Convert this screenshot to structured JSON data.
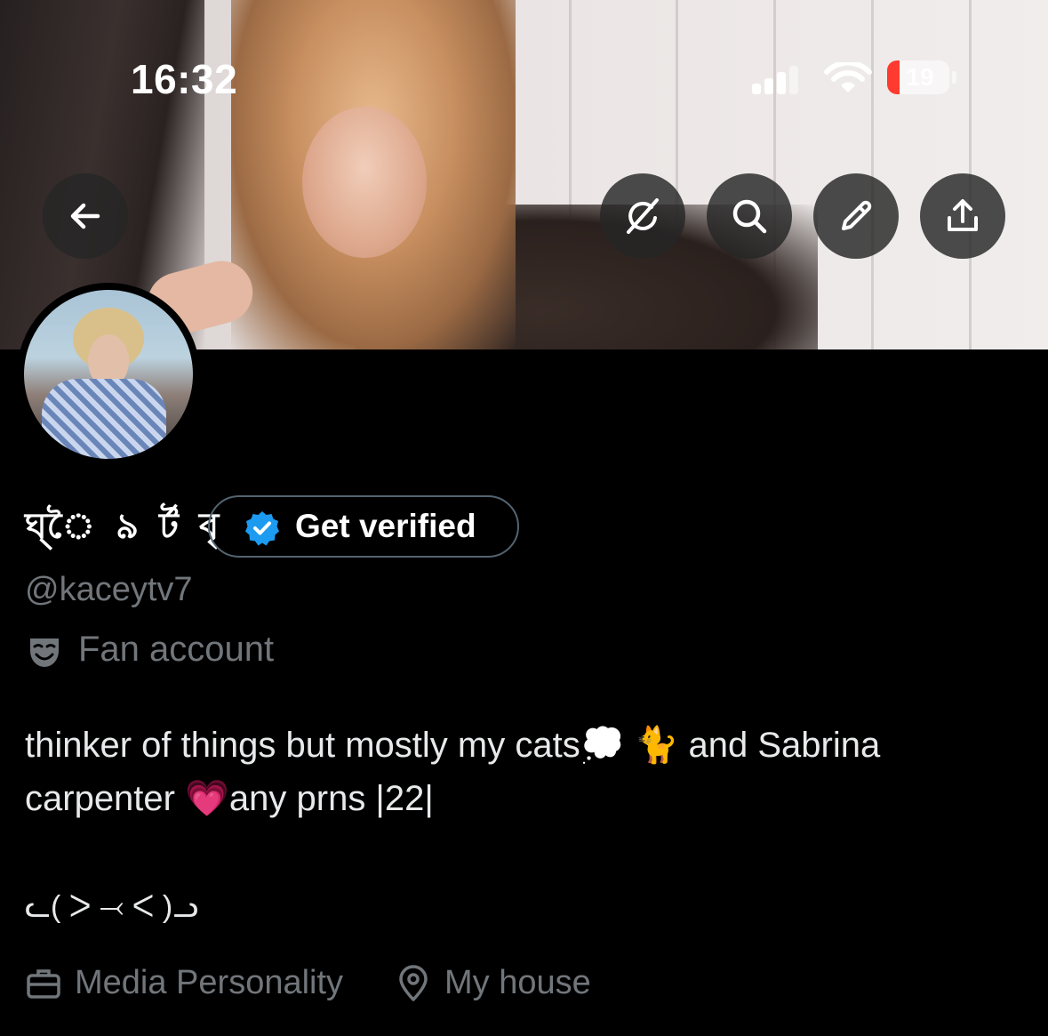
{
  "status_bar": {
    "time": "16:32",
    "battery": "19"
  },
  "profile": {
    "display_name": "ঘ্ৈ ৯ ৰ্ট বৃ",
    "get_verified_label": "Get verified",
    "handle": "@kaceytv7",
    "category": "Fan account",
    "bio_line1": "thinker of things but mostly my cats💭 🐈 and Sabrina",
    "bio_line2": "carpenter 💗any prns |22|",
    "kaomoji": "ᓚ( ᐳ ⤙ ᐸ )ᓗ",
    "profession": "Media Personality",
    "location": "My house"
  },
  "colors": {
    "background": "#000000",
    "muted_text": "#71767b",
    "verified_blue": "#1d9bf0",
    "battery_red": "#ff3b30"
  },
  "icons": [
    "back-arrow-icon",
    "grok-icon",
    "search-icon",
    "pencil-icon",
    "share-icon",
    "verified-badge-icon",
    "theater-mask-icon",
    "briefcase-icon",
    "location-pin-icon"
  ]
}
